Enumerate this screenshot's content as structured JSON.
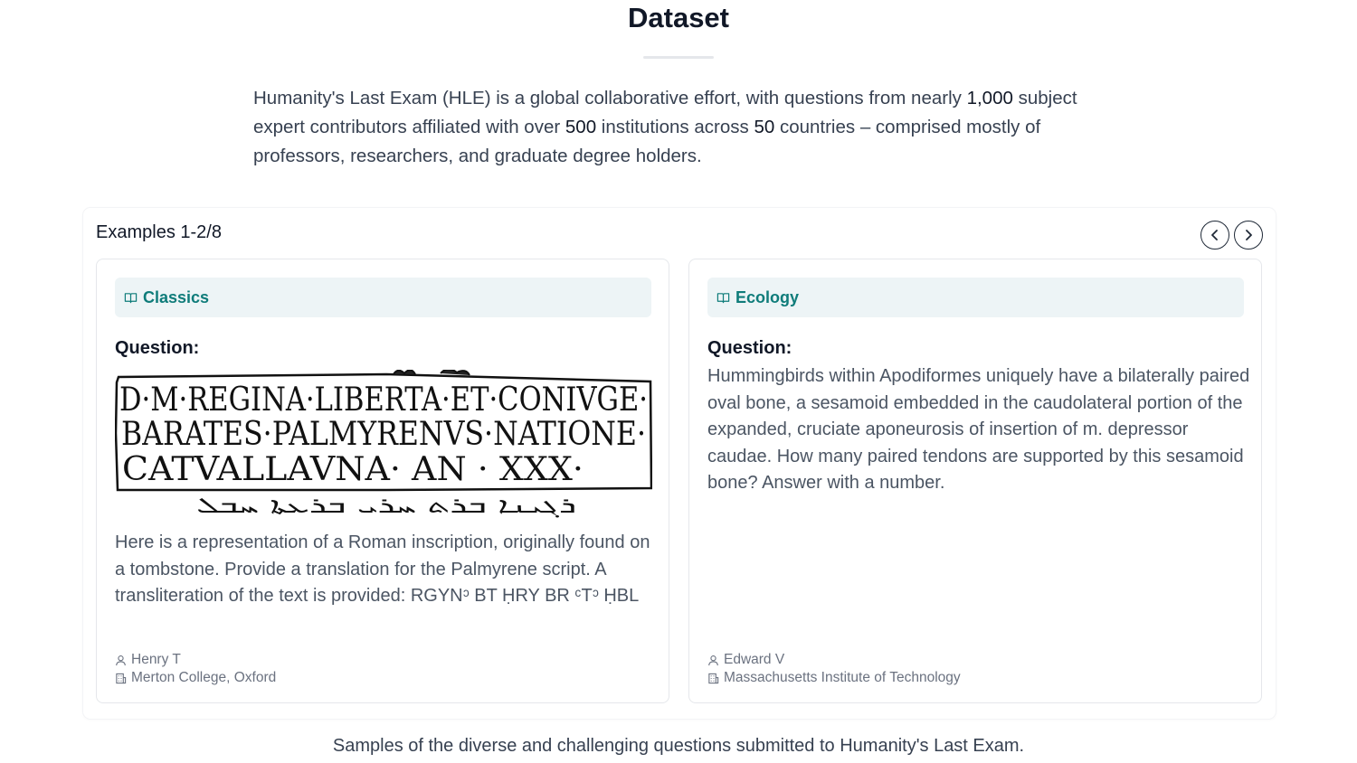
{
  "header": {
    "title": "Dataset"
  },
  "intro": {
    "part1": "Humanity's Last Exam (HLE) is a global collaborative effort, with questions from nearly ",
    "n1": "1,000",
    "part2": " subject expert contributors affiliated with over ",
    "n2": "500",
    "part3": " institutions across ",
    "n3": "50",
    "part4": " countries – comprised mostly of professors, researchers, and graduate degree holders."
  },
  "examples": {
    "heading": "Examples 1-2/8",
    "prev_icon": "chevron-left-icon",
    "next_icon": "chevron-right-icon",
    "cards": [
      {
        "subject": "Classics",
        "subject_icon": "book-open-icon",
        "question_label": "Question:",
        "image": {
          "line1": "D·M·REGINA·LIBERTA·ET·CONIVGE·",
          "line2": "BARATES·PALMYRENVS·NATIONE·",
          "line3": "CATVALLAVNA· AN · XXX·",
          "script": "ܪܓܝܢܐ ܒܪܬ ܚܪܝ ܒܪܥܬܐ ܚܒܠ"
        },
        "question_text": "Here is a representation of a Roman inscription, originally found on a tombstone. Provide a translation for the Palmyrene script. A transliteration of the text is provided: RGYNᵓ BT ḤRY BR ᶜTᵓ ḤBL",
        "author": "Henry T",
        "institution": "Merton College, Oxford",
        "author_icon": "user-icon",
        "institution_icon": "building-icon"
      },
      {
        "subject": "Ecology",
        "subject_icon": "book-open-icon",
        "question_label": "Question:",
        "question_text": "Hummingbirds within Apodiformes uniquely have a bilaterally paired oval bone, a sesamoid embedded in the caudolateral portion of the expanded, cruciate aponeurosis of insertion of m. depressor caudae. How many paired tendons are supported by this sesamoid bone? Answer with a number.",
        "author": "Edward V",
        "institution": "Massachusetts Institute of Technology",
        "author_icon": "user-icon",
        "institution_icon": "building-icon"
      }
    ]
  },
  "caption": "Samples of the diverse and challenging questions submitted to Humanity's Last Exam.",
  "colors": {
    "tag_bg": "#edf4f6",
    "tag_text": "#0f7c7a",
    "border": "#e5e7eb"
  }
}
